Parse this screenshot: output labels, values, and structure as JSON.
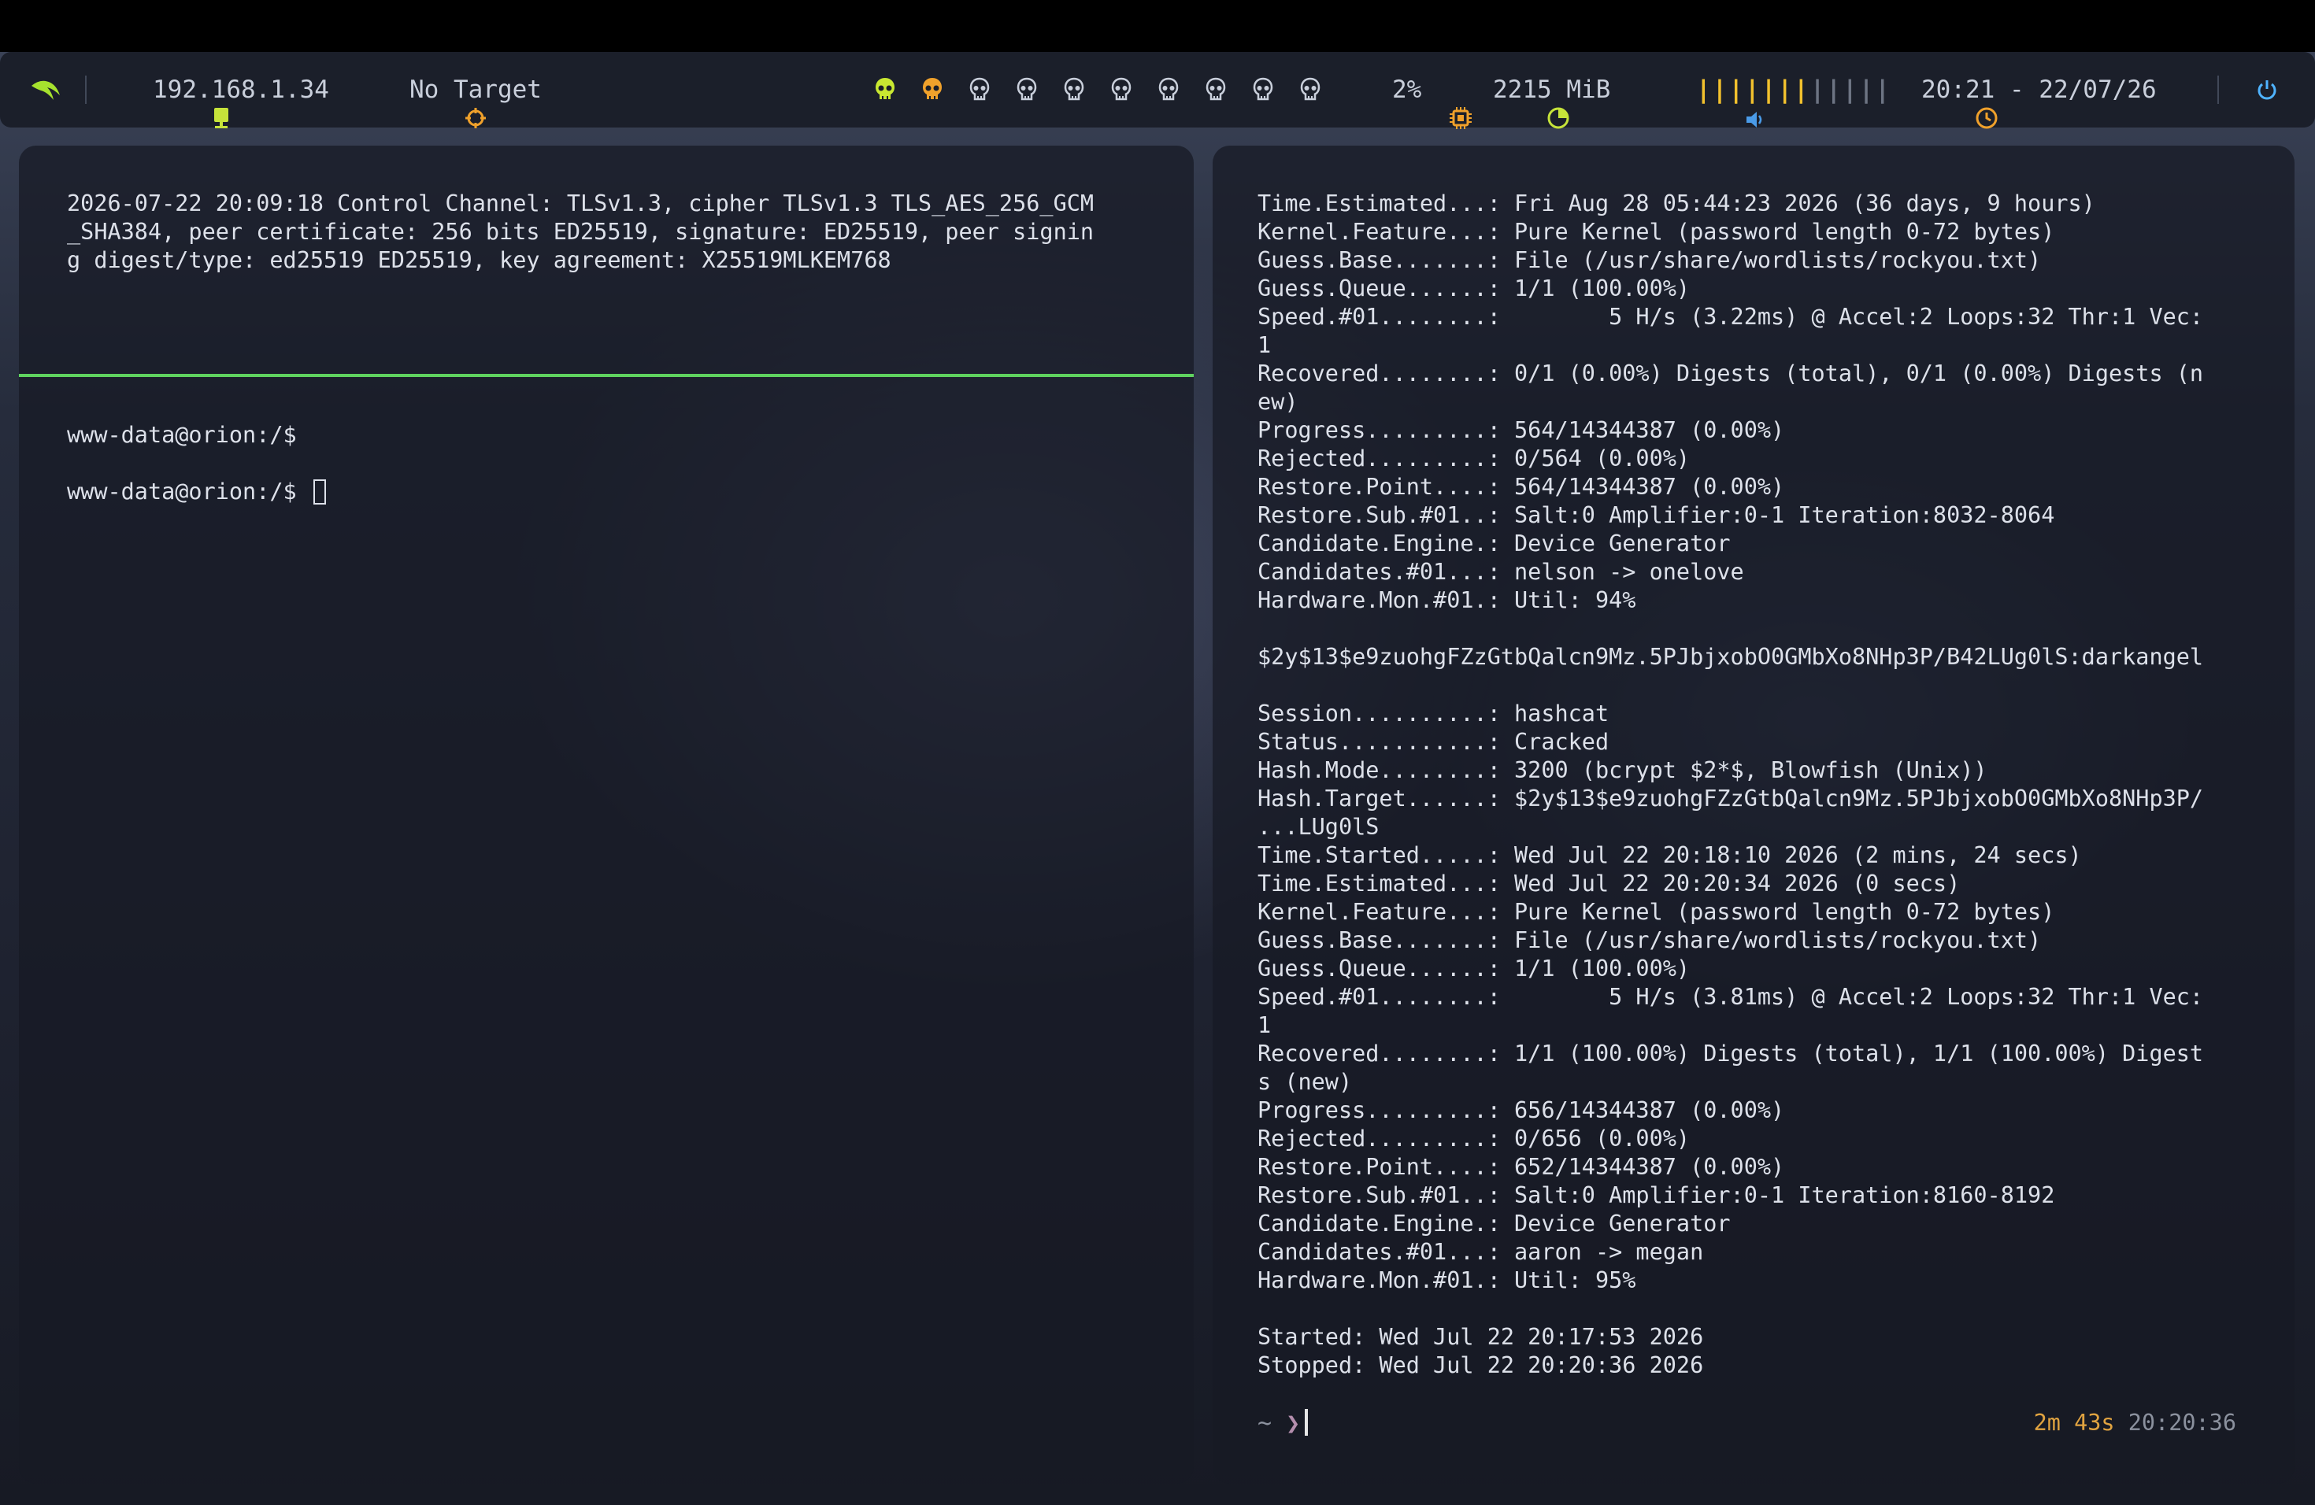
{
  "topbar": {
    "ip": "192.168.1.34",
    "target": "No Target",
    "cpu": "2%",
    "memory": "2215 MiB",
    "volume_bars": "||||||||||||",
    "volume_level": 0.6,
    "clock": "20:21 - 22/07/26",
    "workspaces": [
      {
        "state": "active",
        "color": "#c9e831"
      },
      {
        "state": "occupied",
        "color": "#f0a12b"
      },
      {
        "state": "empty",
        "color": "#c9cfdb"
      },
      {
        "state": "empty",
        "color": "#c9cfdb"
      },
      {
        "state": "empty",
        "color": "#c9cfdb"
      },
      {
        "state": "empty",
        "color": "#c9cfdb"
      },
      {
        "state": "empty",
        "color": "#c9cfdb"
      },
      {
        "state": "empty",
        "color": "#c9cfdb"
      },
      {
        "state": "empty",
        "color": "#c9cfdb"
      },
      {
        "state": "empty",
        "color": "#c9cfdb"
      }
    ],
    "icons": {
      "logo": "dragon-logo-icon",
      "ip": "network-monitor-icon",
      "target": "crosshair-icon",
      "cpu": "cpu-chip-icon",
      "memory": "memory-pie-icon",
      "volume": "speaker-icon",
      "clock": "clock-icon",
      "power": "power-icon"
    },
    "colors": {
      "logo": "#a6e22e",
      "ip_icon": "#c6e33a",
      "target_icon": "#f0a12b",
      "cpu_icon": "#f0a12b",
      "memory_icon": "#c6e33a",
      "volume_icon": "#4a9be8",
      "volume_active": "#f2c12e",
      "volume_inactive": "#6d7483",
      "clock_icon": "#f0a12b",
      "power_icon": "#4fb3ff"
    }
  },
  "left_terminal": {
    "log": "2026-07-22 20:09:18 Control Channel: TLSv1.3, cipher TLSv1.3 TLS_AES_256_GCM\n_SHA384, peer certificate: 256 bits ED25519, signature: ED25519, peer signin\ng digest/type: ed25519 ED25519, key agreement: X25519MLKEM768",
    "prompt1": "www-data@orion:/$",
    "prompt2": "www-data@orion:/$ ",
    "divider_color": "#5fd35f"
  },
  "right_terminal": {
    "output": "Time.Estimated...: Fri Aug 28 05:44:23 2026 (36 days, 9 hours)\nKernel.Feature...: Pure Kernel (password length 0-72 bytes)\nGuess.Base.......: File (/usr/share/wordlists/rockyou.txt)\nGuess.Queue......: 1/1 (100.00%)\nSpeed.#01........:        5 H/s (3.22ms) @ Accel:2 Loops:32 Thr:1 Vec:\n1\nRecovered........: 0/1 (0.00%) Digests (total), 0/1 (0.00%) Digests (n\new)\nProgress.........: 564/14344387 (0.00%)\nRejected.........: 0/564 (0.00%)\nRestore.Point....: 564/14344387 (0.00%)\nRestore.Sub.#01..: Salt:0 Amplifier:0-1 Iteration:8032-8064\nCandidate.Engine.: Device Generator\nCandidates.#01...: nelson -> onelove\nHardware.Mon.#01.: Util: 94%\n\n$2y$13$e9zuohgFZzGtbQalcn9Mz.5PJbjxobO0GMbXo8NHp3P/B42LUg0lS:darkangel\n\nSession..........: hashcat\nStatus...........: Cracked\nHash.Mode........: 3200 (bcrypt $2*$, Blowfish (Unix))\nHash.Target......: $2y$13$e9zuohgFZzGtbQalcn9Mz.5PJbjxobO0GMbXo8NHp3P/\n...LUg0lS\nTime.Started.....: Wed Jul 22 20:18:10 2026 (2 mins, 24 secs)\nTime.Estimated...: Wed Jul 22 20:20:34 2026 (0 secs)\nKernel.Feature...: Pure Kernel (password length 0-72 bytes)\nGuess.Base.......: File (/usr/share/wordlists/rockyou.txt)\nGuess.Queue......: 1/1 (100.00%)\nSpeed.#01........:        5 H/s (3.81ms) @ Accel:2 Loops:32 Thr:1 Vec:\n1\nRecovered........: 1/1 (100.00%) Digests (total), 1/1 (100.00%) Digest\ns (new)\nProgress.........: 656/14344387 (0.00%)\nRejected.........: 0/656 (0.00%)\nRestore.Point....: 652/14344387 (0.00%)\nRestore.Sub.#01..: Salt:0 Amplifier:0-1 Iteration:8160-8192\nCandidate.Engine.: Device Generator\nCandidates.#01...: aaron -> megan\nHardware.Mon.#01.: Util: 95%\n\nStarted: Wed Jul 22 20:17:53 2026\nStopped: Wed Jul 22 20:20:36 2026",
    "prompt_dir": "~",
    "prompt_symbol": "❯",
    "duration": "2m 43s",
    "time": "20:20:36"
  }
}
